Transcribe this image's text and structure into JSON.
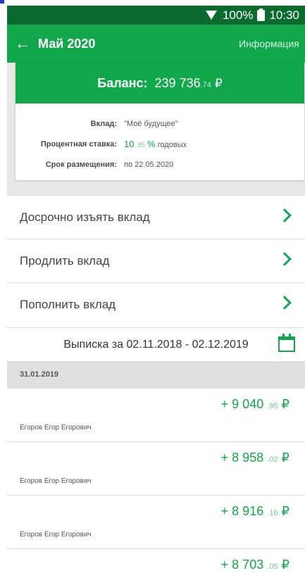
{
  "status": {
    "battery": "100%",
    "time": "10:30"
  },
  "header": {
    "title": "Май 2020",
    "info": "Информация"
  },
  "balance": {
    "label": "Баланс:",
    "amount": "239 736",
    "kopecks": ".74",
    "currency": "₽"
  },
  "details": [
    {
      "key": "Вклад:",
      "value": "\"Моё будущее\""
    },
    {
      "key": "Процентная ставка:",
      "value_main": "10",
      "value_frac": ".85",
      "value_pct": "%",
      "value_suffix": " годовых"
    },
    {
      "key": "Срок размещения:",
      "value": "по 22.05.2020"
    }
  ],
  "actions": [
    {
      "label": "Досрочно изъять вклад"
    },
    {
      "label": "Продлить вклад"
    },
    {
      "label": "Пополнить вклад"
    }
  ],
  "statement": {
    "label": "Выписка за 02.11.2018 - 02.12.2019"
  },
  "date_group": "31.01.2019",
  "transactions": [
    {
      "amount": "+ 9 040",
      "kopecks": ".95",
      "currency": "₽",
      "name": "Егоров Егор Егорович"
    },
    {
      "amount": "+ 8 958",
      "kopecks": ".02",
      "currency": "₽",
      "name": "Егоров Егор Егорович"
    },
    {
      "amount": "+ 8 916",
      "kopecks": ".16",
      "currency": "₽",
      "name": "Егоров Егор Егорович"
    },
    {
      "amount": "+ 8 703",
      "kopecks": ".05",
      "currency": "₽",
      "name": ""
    }
  ],
  "colors": {
    "accent": "#10a84a",
    "status_bar": "#0b6b2f"
  }
}
